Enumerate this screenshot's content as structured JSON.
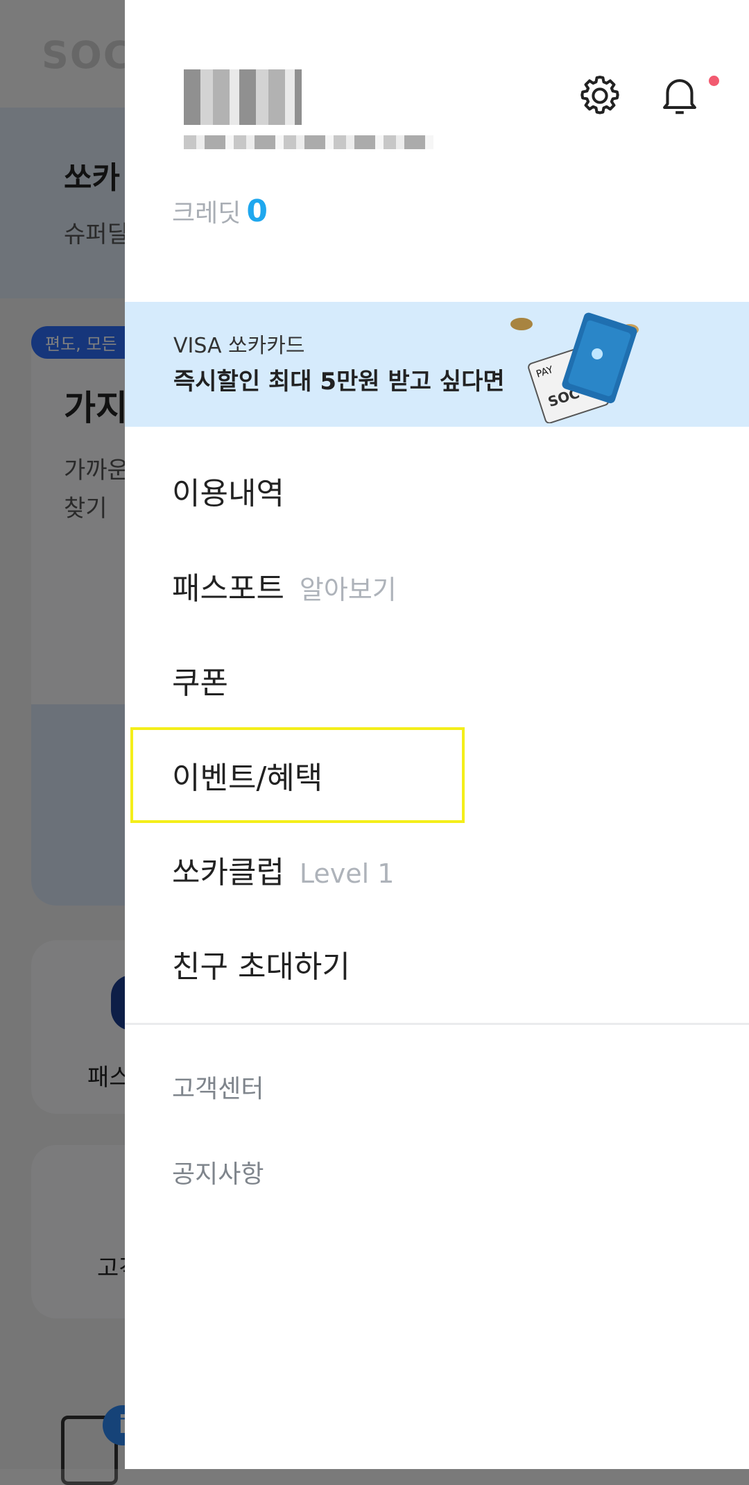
{
  "background": {
    "logo": "SOC",
    "hero_title": "쏘카",
    "hero_subtitle": "슈퍼딜",
    "chip": "편도, 모든",
    "card_title": "가지",
    "card_text_1": "가까운",
    "card_text_2": "찾기",
    "tile_1_label": "패스",
    "tile_2_label": "고객",
    "info_badge": "i"
  },
  "drawer": {
    "header": {
      "settings_icon": "gear-icon",
      "notification_icon": "bell-icon",
      "notification_dot_color": "#f25a70"
    },
    "credit": {
      "label": "크레딧",
      "value": "0"
    },
    "banner": {
      "line1": "VISA 쏘카카드",
      "line2": "즉시할인 최대 5만원 받고 싶다면",
      "card_text": "SOC",
      "pay_text": "PAY"
    },
    "menu": [
      {
        "label": "이용내역",
        "sub": ""
      },
      {
        "label": "패스포트",
        "sub": "알아보기"
      },
      {
        "label": "쿠폰",
        "sub": ""
      },
      {
        "label": "이벤트/혜택",
        "sub": ""
      },
      {
        "label": "쏘카클럽",
        "sub": "Level 1"
      },
      {
        "label": "친구 초대하기",
        "sub": ""
      }
    ],
    "minor_menu": [
      {
        "label": "고객센터"
      },
      {
        "label": "공지사항"
      }
    ]
  }
}
